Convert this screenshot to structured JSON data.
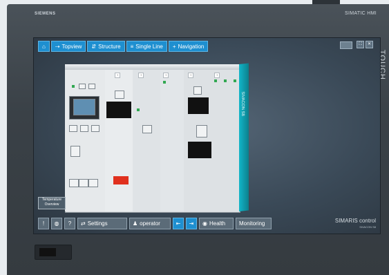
{
  "device": {
    "brand": "SIEMENS",
    "model": "SIMATIC HMI",
    "touch_label": "TOUCH"
  },
  "nav": {
    "home_icon": "home-icon",
    "items": [
      {
        "label": "Topview",
        "icon": "topview-icon"
      },
      {
        "label": "Structure",
        "icon": "structure-icon"
      },
      {
        "label": "Single Line",
        "icon": "single-line-icon"
      },
      {
        "label": "Navigation",
        "icon": "plus-icon"
      }
    ]
  },
  "window_controls": [
    "keyboard-icon",
    "fullscreen-icon",
    "close-icon"
  ],
  "screen": {
    "temperature_button": "Temperature Overview",
    "cabinet_side_label": "SIVACON S8"
  },
  "bottom_bar": {
    "alarm_label": "!",
    "help_label": "?",
    "settings_label": "Settings",
    "user_label": "operator",
    "health_label": "Health",
    "monitoring_label": "Monitoring"
  },
  "branding": {
    "product": "SIMARIS control",
    "sub": "SIVACON S8"
  },
  "colors": {
    "accent": "#1e8fd0",
    "cabinet_side": "#12b6c9",
    "alarm_red": "#e0301e"
  }
}
